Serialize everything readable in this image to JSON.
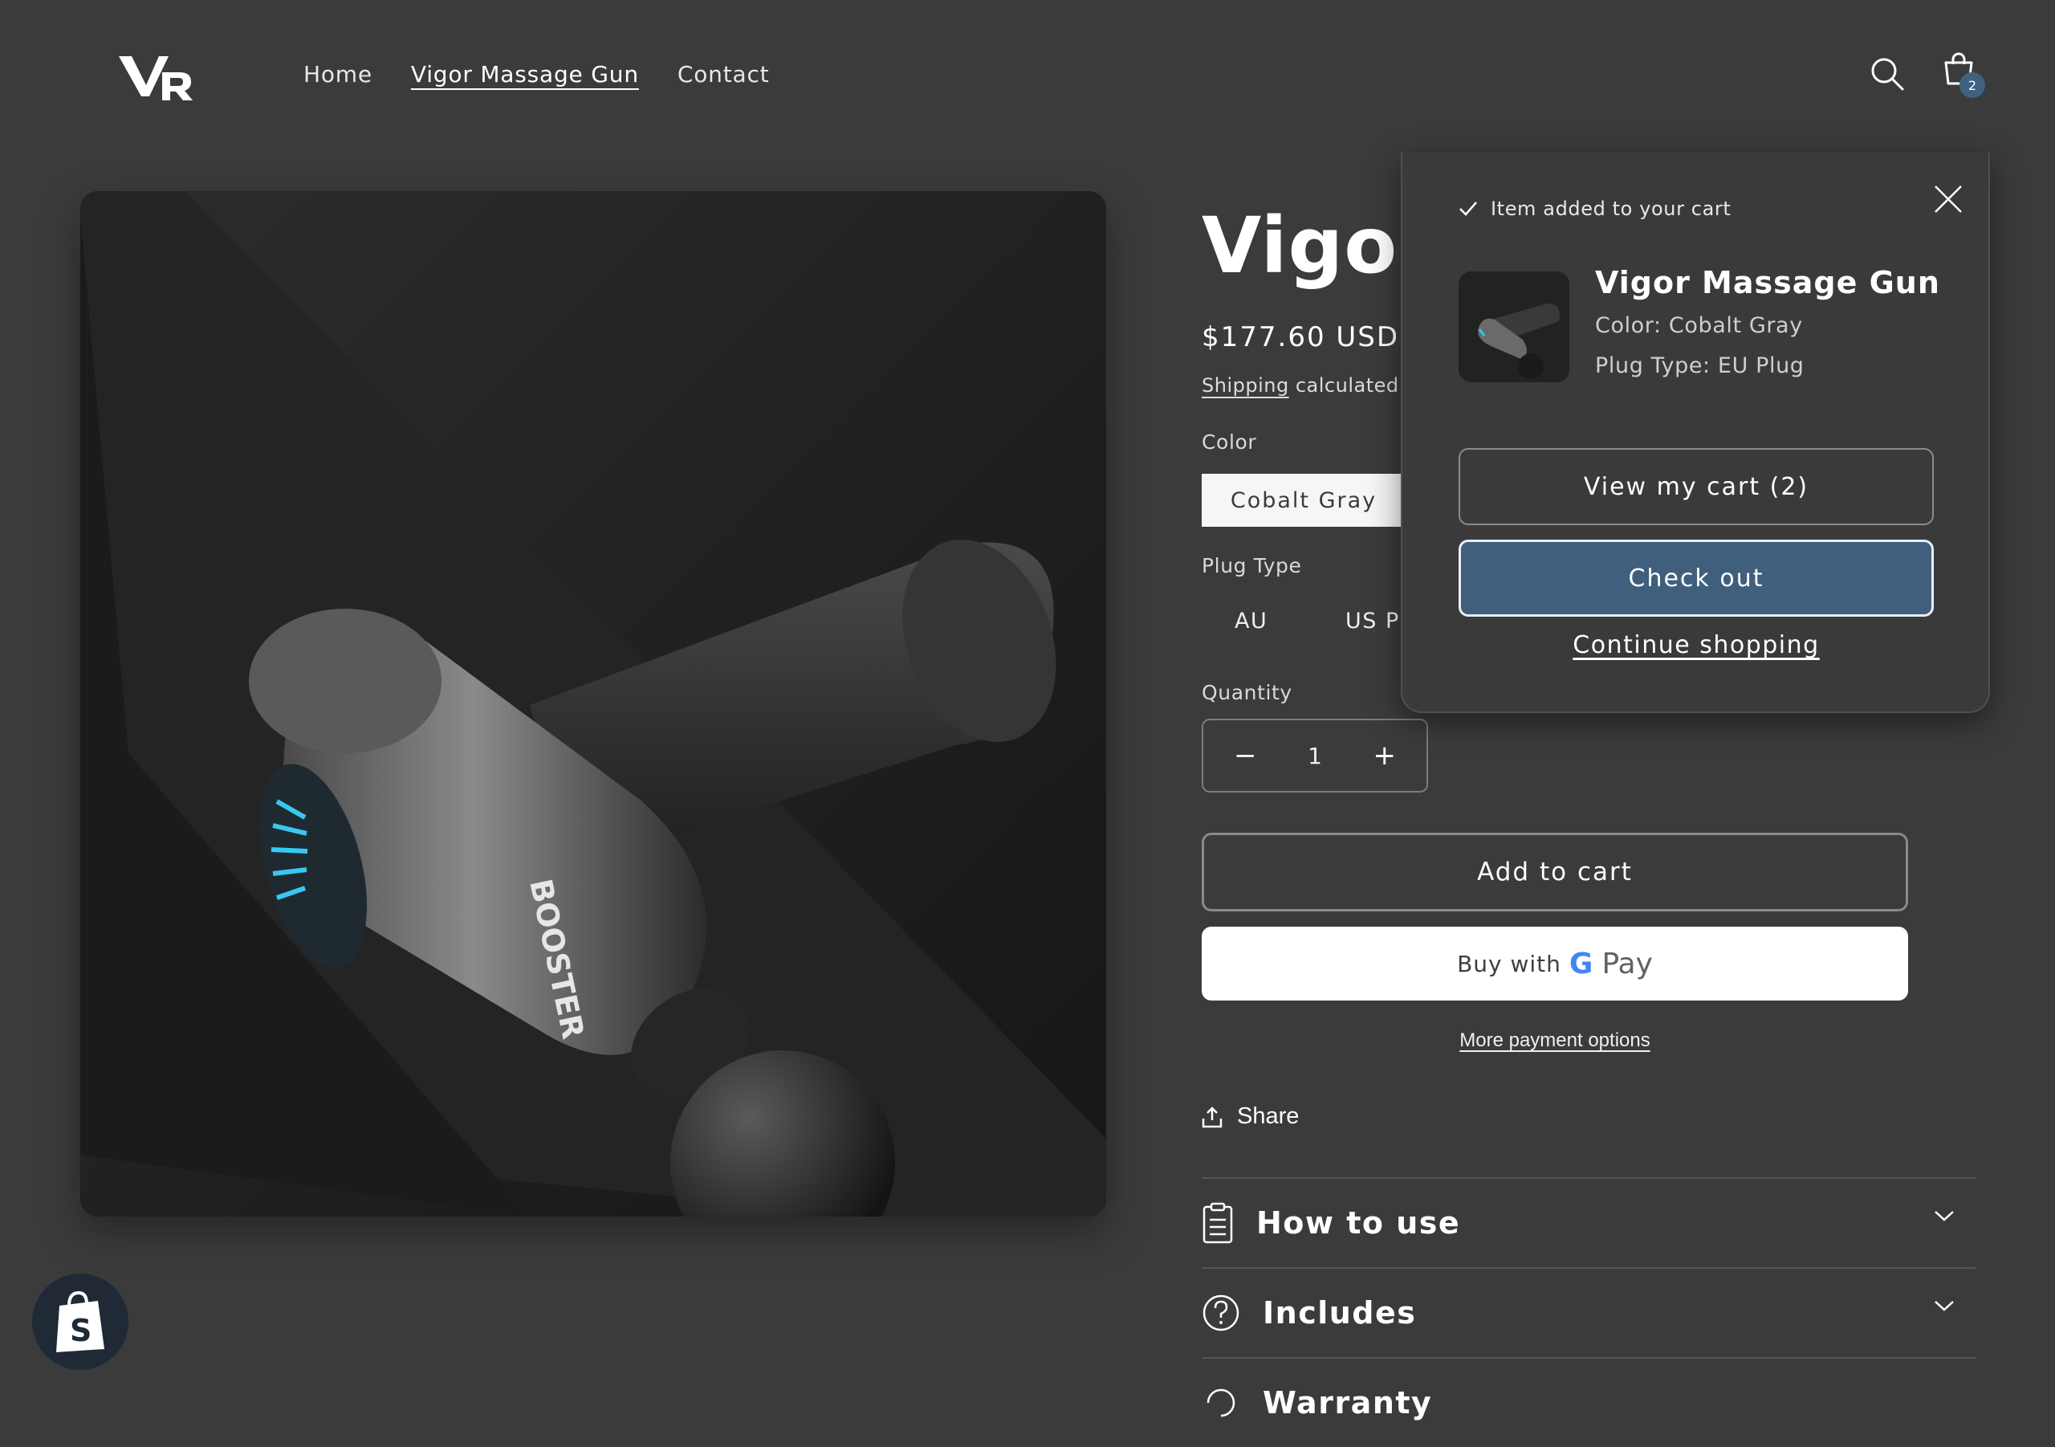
{
  "header": {
    "nav": [
      {
        "label": "Home"
      },
      {
        "label": "Vigor Massage Gun"
      },
      {
        "label": "Contact"
      }
    ],
    "cart_count": "2"
  },
  "product": {
    "title": "Vigor",
    "price": "$177.60 USD",
    "shipping_link": "Shipping",
    "shipping_rest": "calculated",
    "color_label": "Color",
    "color_selected": "Cobalt Gray",
    "plug_label": "Plug Type",
    "plug_options": [
      "AU",
      "US Pl"
    ],
    "quantity_label": "Quantity",
    "quantity_value": "1",
    "quantity_minus": "−",
    "quantity_plus": "+",
    "add_to_cart": "Add to cart",
    "buy_with": "Buy with",
    "gpay_pay": "Pay",
    "more_payment": "More payment options",
    "share": "Share",
    "accordion": [
      {
        "title": "How to use"
      },
      {
        "title": "Includes"
      },
      {
        "title": "Warranty"
      }
    ]
  },
  "cart_popup": {
    "status": "Item added to your cart",
    "item_name": "Vigor Massage Gun",
    "item_color": "Color: Cobalt Gray",
    "item_plug": "Plug Type: EU Plug",
    "view_cart": "View my cart (2)",
    "checkout": "Check out",
    "continue": "Continue shopping"
  },
  "colors": {
    "background": "#3b3b3b",
    "checkout_button": "#3f5f7c",
    "badge": "#3f6280"
  }
}
